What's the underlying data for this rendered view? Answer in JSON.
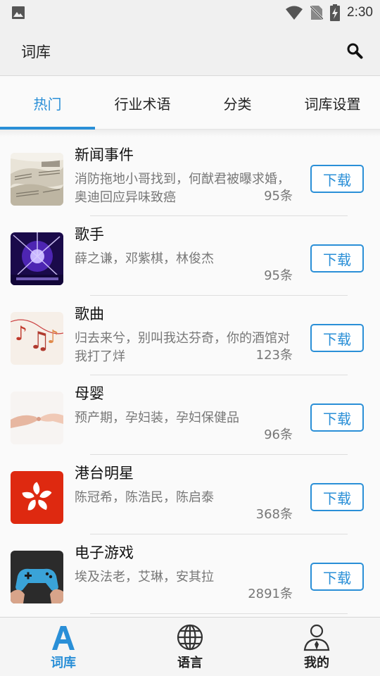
{
  "status_bar": {
    "time": "2:30"
  },
  "app_bar": {
    "title": "词库"
  },
  "tabs": [
    {
      "label": "热门"
    },
    {
      "label": "行业术语"
    },
    {
      "label": "分类"
    },
    {
      "label": "词库设置"
    }
  ],
  "active_tab": 0,
  "download_label": "下载",
  "items": [
    {
      "title": "新闻事件",
      "desc": "消防拖地小哥找到，何猷君被曝求婚，奥迪回应异味致癌",
      "count": "95条",
      "icon": "newspaper-thumbnail"
    },
    {
      "title": "歌手",
      "desc": "薛之谦，邓紫棋，林俊杰",
      "count": "95条",
      "icon": "concert-stage-thumbnail"
    },
    {
      "title": "歌曲",
      "desc": "归去来兮，别叫我达芬奇，你的酒馆对我打了烊",
      "count": "123条",
      "icon": "music-notes-thumbnail"
    },
    {
      "title": "母婴",
      "desc": "预产期，孕妇装，孕妇保健品",
      "count": "96条",
      "icon": "baby-hand-thumbnail"
    },
    {
      "title": "港台明星",
      "desc": "陈冠希，陈浩民，陈启泰",
      "count": "368条",
      "icon": "hong-kong-flag-thumbnail"
    },
    {
      "title": "电子游戏",
      "desc": "埃及法老，艾琳，安其拉",
      "count": "2891条",
      "icon": "game-controller-thumbnail"
    }
  ],
  "bottom_nav": [
    {
      "label": "词库",
      "icon": "letter-a-icon"
    },
    {
      "label": "语言",
      "icon": "globe-icon"
    },
    {
      "label": "我的",
      "icon": "person-icon"
    }
  ],
  "active_nav": 0,
  "colors": {
    "accent": "#2a8fd7",
    "text": "#222222",
    "secondary_text": "#777777",
    "hk_red": "#de2910"
  }
}
